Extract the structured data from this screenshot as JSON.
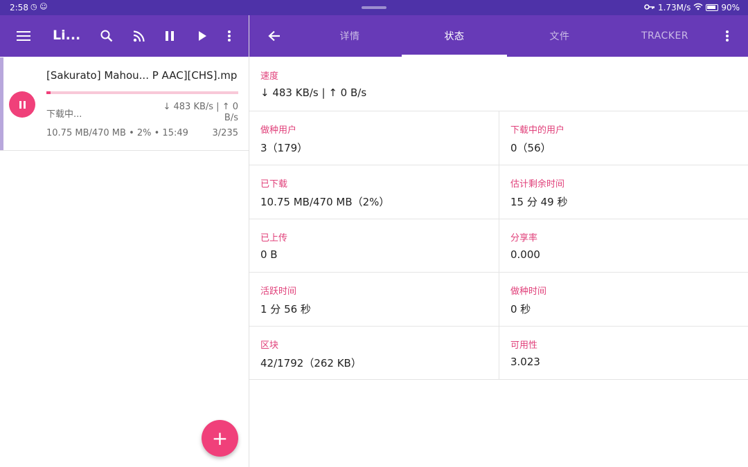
{
  "statusbar": {
    "time": "2:58",
    "left_icons": "◷ ☺",
    "net_speed": "1.73M/s",
    "battery": "90%"
  },
  "left_bar": {
    "title": "Li...",
    "icons": [
      "menu-icon",
      "search-icon",
      "rss-icon",
      "pause-icon",
      "play-icon",
      "more-vert-icon"
    ]
  },
  "tabs": [
    {
      "label": "详情",
      "active": false
    },
    {
      "label": "状态",
      "active": true
    },
    {
      "label": "文件",
      "active": false
    },
    {
      "label": "TRACKER",
      "active": false
    }
  ],
  "torrent": {
    "name": "[Sakurato] Mahou...  P AAC][CHS].mp",
    "progress_percent": 2,
    "status": "下载中...",
    "speed": "↓ 483 KB/s | ↑ 0 B/s",
    "meta": "10.75 MB/470 MB • 2% • 15:49",
    "pieces": "3/235"
  },
  "fab_label": "+",
  "details": {
    "speed_label": "速度",
    "speed_value": "↓ 483 KB/s | ↑ 0 B/s",
    "seeders_label": "做种用户",
    "seeders_value": "3（179）",
    "leechers_label": "下载中的用户",
    "leechers_value": "0（56）",
    "downloaded_label": "已下载",
    "downloaded_value": "10.75 MB/470 MB（2%）",
    "eta_label": "估计剩余时间",
    "eta_value": "15 分 49 秒",
    "uploaded_label": "已上传",
    "uploaded_value": "0 B",
    "ratio_label": "分享率",
    "ratio_value": "0.000",
    "active_label": "活跃时间",
    "active_value": "1 分 56 秒",
    "seeding_label": "做种时间",
    "seeding_value": "0 秒",
    "pieces_label": "区块",
    "pieces_value": "42/1792（262 KB）",
    "availability_label": "可用性",
    "availability_value": "3.023"
  },
  "colors": {
    "primary": "#673ab7",
    "status_bar": "#4e32a8",
    "accent": "#f0407a"
  }
}
